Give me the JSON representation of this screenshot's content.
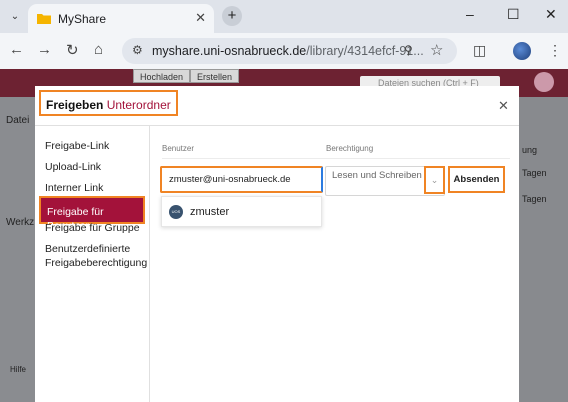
{
  "browser": {
    "tab_title": "MyShare",
    "url_host": "myshare.uni-osnabrueck.de",
    "url_path": "/library/4314efcf-91..."
  },
  "background": {
    "buttons": [
      "Hochladen",
      "Erstellen"
    ],
    "search_placeholder": "Dateien suchen (Ctrl + F)",
    "left_text": [
      "Datei",
      "Werkz",
      "Hilfe"
    ],
    "right_text": [
      "ung",
      "Tagen",
      "Tagen"
    ]
  },
  "modal": {
    "title_prefix": "Freigeben",
    "title_folder": "Unterordner",
    "menu": [
      "Freigabe-Link",
      "Upload-Link",
      "Interner Link",
      "Freigabe für Benutzer",
      "Freigabe für Gruppe",
      "Benutzerdefinierte Freigabeberechtigung"
    ],
    "active_menu_index": 3,
    "column_user": "Benutzer",
    "column_permission": "Berechtigung",
    "user_input_value": "zmuster@uni-osnabrueck.de",
    "permission_value": "Lesen und Schreiben",
    "submit_label": "Absenden",
    "suggestion": {
      "name": "zmuster",
      "avatar_text": "UNIVERSITÄT OSNABRÜCK"
    }
  },
  "colors": {
    "accent": "#a3123a",
    "highlight": "#f08424"
  }
}
